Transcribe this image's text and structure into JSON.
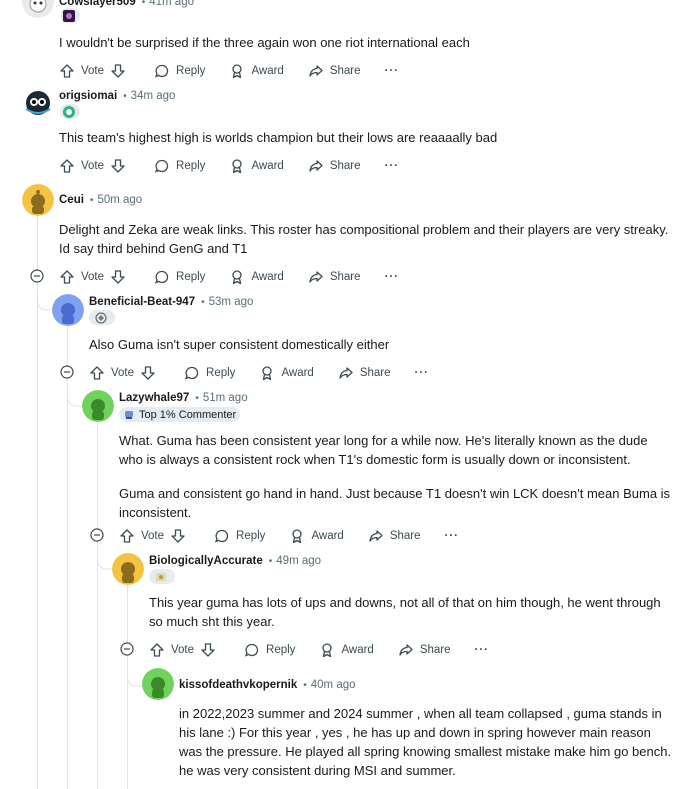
{
  "actions": {
    "vote": "Vote",
    "reply": "Reply",
    "award": "Award",
    "share": "Share",
    "more": "···"
  },
  "comments": [
    {
      "username": "Cowslayer509",
      "time": "41m ago",
      "text": [
        "I wouldn't be surprised if the three again won one riot international each"
      ],
      "flair": ""
    },
    {
      "username": "origsiomai",
      "time": "34m ago",
      "text": [
        "This team's highest high is worlds champion but their lows are reaaaally bad"
      ],
      "flair": ""
    },
    {
      "username": "Ceui",
      "time": "50m ago",
      "text": [
        "Delight and Zeka are weak links. This roster has compositional problem and their players are very streaky.",
        "Id say third behind GenG and T1"
      ],
      "flair": ""
    },
    {
      "username": "Beneficial-Beat-947",
      "time": "53m ago",
      "text": [
        "Also Guma isn't super consistent domestically either"
      ],
      "flair": ""
    },
    {
      "username": "Lazywhale97",
      "time": "51m ago",
      "flair": "Top 1% Commenter",
      "text": [
        "What. Guma has been consistent year long for a while now. He's literally known as the dude",
        "who is always a consistent rock when T1's domestic form is usually down or inconsistent.",
        "",
        "Guma and consistent go hand in hand. Just because T1 doesn't win LCK doesn't mean Buma is",
        "inconsistent."
      ]
    },
    {
      "username": "BiologicallyAccurate",
      "time": "49m ago",
      "text": [
        "This year guma has lots of ups and downs, not all of that on him though, he went through",
        "so much sht this year."
      ],
      "flair": ""
    },
    {
      "username": "kissofdeathvkopernik",
      "time": "40m ago",
      "text": [
        "in 2022,2023 summer and 2024 summer , when all team collapsed , guma stands in",
        "his lane :) For this year , yes , he has up and down in spring however main reason",
        "was the pressure. He played all spring knowing smallest mistake make him go bench.",
        "he was very consistent during MSI and summer."
      ],
      "flair": ""
    }
  ],
  "colors": {
    "accent": "#0079d3",
    "muted": "#576f76",
    "thread_line": "#e0e3e5"
  }
}
